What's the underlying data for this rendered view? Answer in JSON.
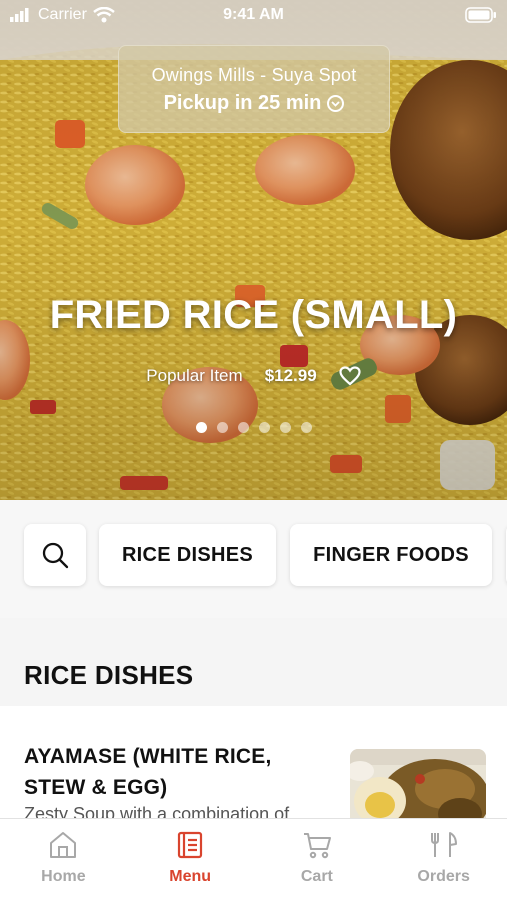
{
  "status_bar": {
    "carrier": "Carrier",
    "time": "9:41 AM"
  },
  "pickup": {
    "store": "Owings Mills - Suya Spot",
    "time_label": "Pickup in 25 min"
  },
  "hero": {
    "title": "FRIED RICE (SMALL)",
    "badge": "Popular Item",
    "price": "$12.99",
    "slides_total": 6,
    "active_slide": 1
  },
  "categories": [
    "RICE DISHES",
    "FINGER FOODS"
  ],
  "section_title": "RICE DISHES",
  "menu_items": [
    {
      "name": "AYAMASE (WHITE RICE, STEW & EGG)",
      "description": "Zesty Soup with a combination of"
    }
  ],
  "tabs": [
    {
      "label": "Home",
      "icon": "home-icon",
      "active": false
    },
    {
      "label": "Menu",
      "icon": "menu-icon",
      "active": true
    },
    {
      "label": "Cart",
      "icon": "cart-icon",
      "active": false
    },
    {
      "label": "Orders",
      "icon": "orders-icon",
      "active": false
    }
  ],
  "colors": {
    "accent": "#d9442e",
    "inactive": "#a8a8a8"
  }
}
